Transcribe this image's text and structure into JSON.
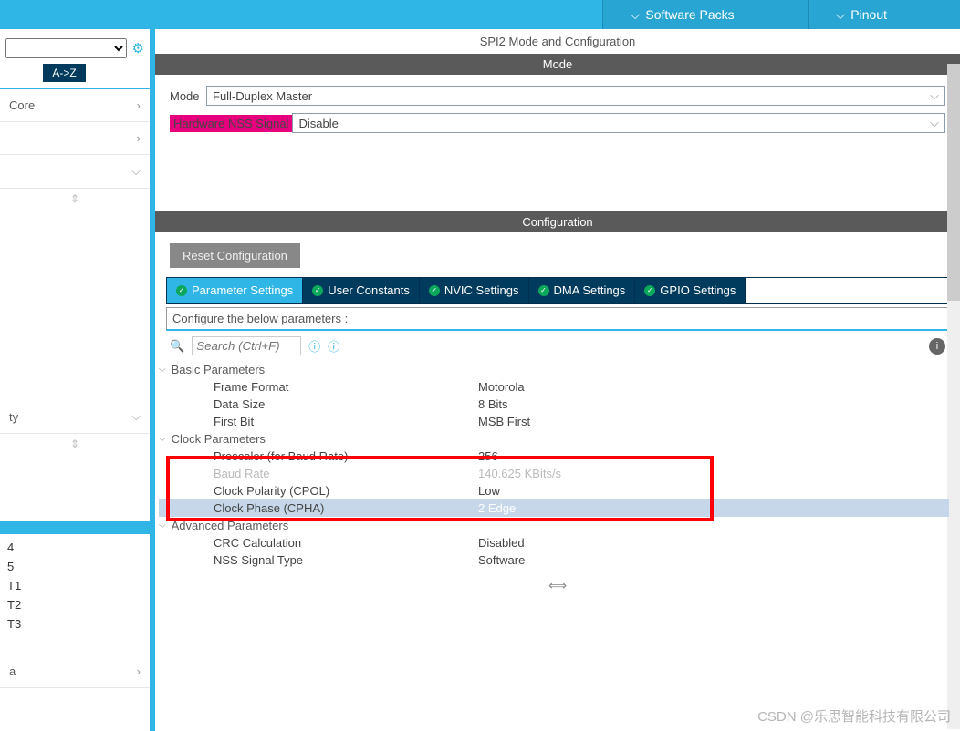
{
  "topmenu": {
    "software_packs": "Software Packs",
    "pinout": "Pinout"
  },
  "sidebar": {
    "sort_tab": "A->Z",
    "cats": [
      "Core",
      "",
      "",
      "ty"
    ],
    "items": {
      "l1": "4",
      "l2": "5",
      "l3": "T1",
      "l4": "T2",
      "l5": "T3",
      "l6": "a"
    }
  },
  "main": {
    "title": "SPI2 Mode and Configuration",
    "mode_bar": "Mode",
    "mode_label": "Mode",
    "mode_value": "Full-Duplex Master",
    "nss_label": "Hardware NSS Signal",
    "nss_value": "Disable",
    "config_bar": "Configuration",
    "reset_btn": "Reset Configuration",
    "tabs": {
      "param": "Parameter Settings",
      "user": "User Constants",
      "nvic": "NVIC Settings",
      "dma": "DMA Settings",
      "gpio": "GPIO Settings"
    },
    "desc": "Configure the below parameters :",
    "search_placeholder": "Search (Ctrl+F)",
    "groups": {
      "basic": "Basic Parameters",
      "clock": "Clock Parameters",
      "adv": "Advanced Parameters"
    },
    "params": {
      "frame_format": {
        "k": "Frame Format",
        "v": "Motorola"
      },
      "data_size": {
        "k": "Data Size",
        "v": "8 Bits"
      },
      "first_bit": {
        "k": "First Bit",
        "v": "MSB First"
      },
      "prescaler": {
        "k": "Prescaler (for Baud Rate)",
        "v": "256"
      },
      "baud": {
        "k": "Baud Rate",
        "v": "140.625 KBits/s"
      },
      "cpol": {
        "k": "Clock Polarity (CPOL)",
        "v": "Low"
      },
      "cpha": {
        "k": "Clock Phase (CPHA)",
        "v": "2 Edge"
      },
      "crc": {
        "k": "CRC Calculation",
        "v": "Disabled"
      },
      "nss_type": {
        "k": "NSS Signal Type",
        "v": "Software"
      }
    }
  },
  "watermark": "CSDN @乐思智能科技有限公司"
}
